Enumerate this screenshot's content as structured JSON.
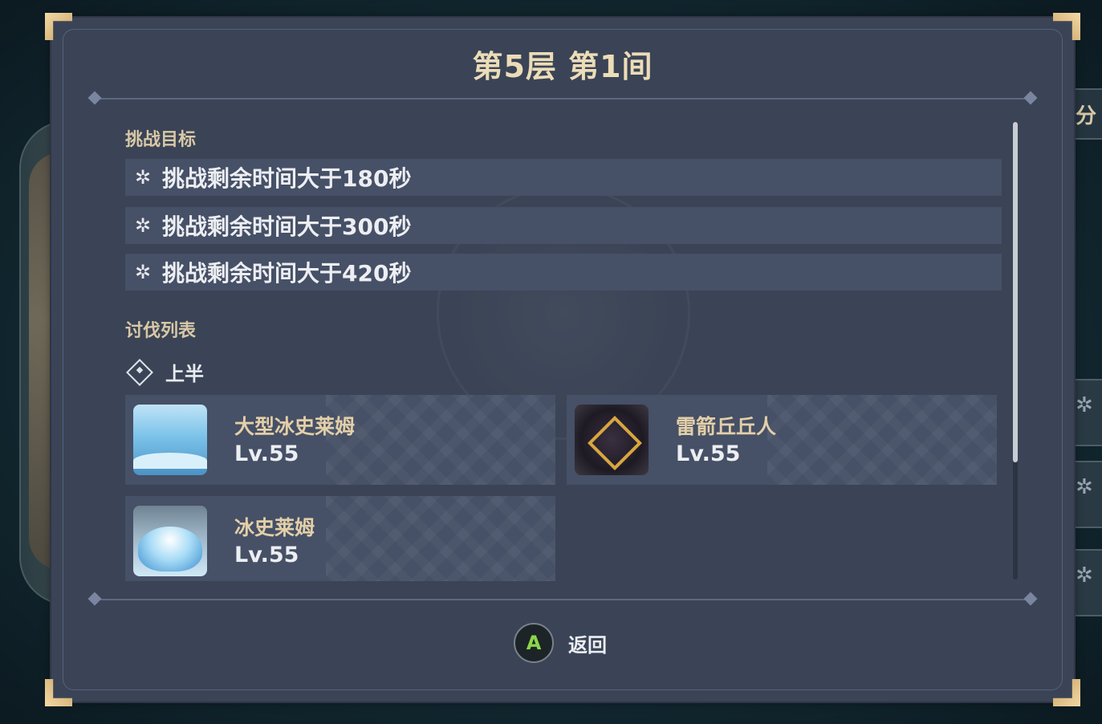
{
  "title": "第5层 第1间",
  "objectives_label": "挑战目标",
  "objectives": [
    {
      "icon": "snowflake-star-icon",
      "text": "挑战剩余时间大于180秒"
    },
    {
      "icon": "snowflake-star-icon",
      "text": "挑战剩余时间大于300秒"
    },
    {
      "icon": "snowflake-star-icon",
      "text": "挑战剩余时间大于420秒"
    }
  ],
  "enemy_list_label": "讨伐列表",
  "half_label": "上半",
  "enemies": [
    {
      "name": "大型冰史莱姆",
      "level": "Lv.55"
    },
    {
      "name": "雷箭丘丘人",
      "level": "Lv.55"
    },
    {
      "name": "冰史莱姆",
      "level": "Lv.55"
    }
  ],
  "back": {
    "key": "A",
    "label": "返回"
  },
  "side_tab_text": "分",
  "colors": {
    "panel": "#3a4456",
    "row": "#465066",
    "title": "#ecdcb8",
    "accent_gold": "#d8c8a6",
    "a_button": "#8cd64a"
  }
}
